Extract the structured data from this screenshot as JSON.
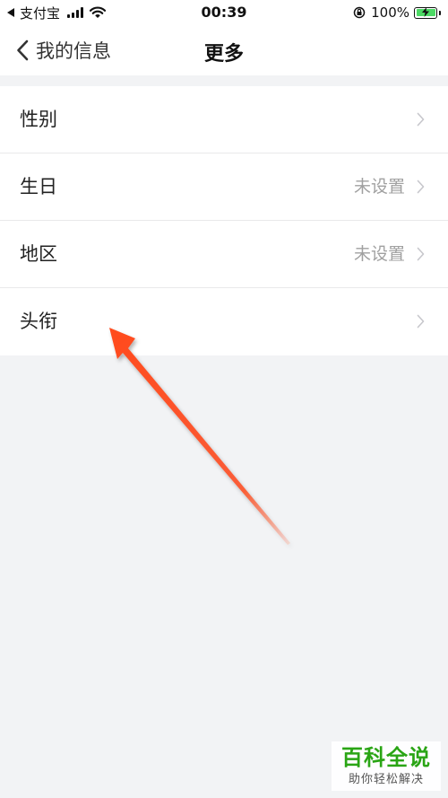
{
  "status_bar": {
    "carrier": "支付宝",
    "time": "00:39",
    "battery_percent": "100%",
    "battery_color": "#4cd964"
  },
  "nav": {
    "back_label": "我的信息",
    "title": "更多"
  },
  "rows": [
    {
      "label": "性别",
      "value": ""
    },
    {
      "label": "生日",
      "value": "未设置"
    },
    {
      "label": "地区",
      "value": "未设置"
    },
    {
      "label": "头衔",
      "value": ""
    }
  ],
  "watermark": {
    "title": "百科全说",
    "subtitle": "助你轻松解决"
  },
  "colors": {
    "background": "#f2f3f5",
    "arrow": "#ff4a1c",
    "watermark_green": "#2aa515"
  }
}
